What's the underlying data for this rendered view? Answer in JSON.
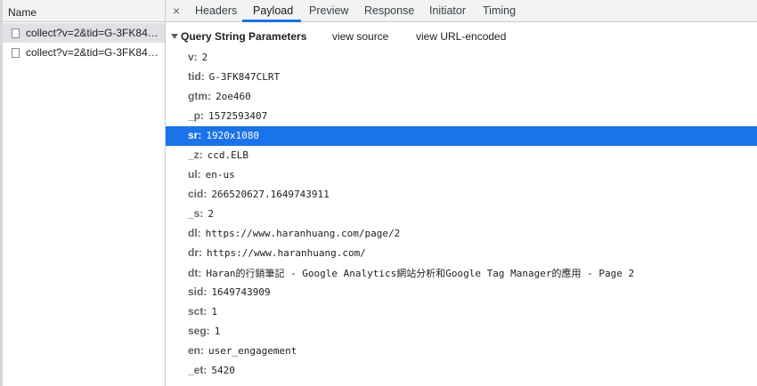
{
  "left_panel": {
    "header": "Name",
    "requests": [
      {
        "label": "collect?v=2&tid=G-3FK84…",
        "selected": true
      },
      {
        "label": "collect?v=2&tid=G-3FK84…",
        "selected": false
      }
    ]
  },
  "tabs": {
    "close_symbol": "×",
    "items": [
      "Headers",
      "Payload",
      "Preview",
      "Response",
      "Initiator",
      "Timing"
    ],
    "active": "Payload"
  },
  "payload": {
    "section_title": "Query String Parameters",
    "view_source": "view source",
    "view_url_encoded": "view URL-encoded",
    "params": [
      {
        "key": "v:",
        "value": "2"
      },
      {
        "key": "tid:",
        "value": "G-3FK847CLRT"
      },
      {
        "key": "gtm:",
        "value": "2oe460"
      },
      {
        "key": "_p:",
        "value": "1572593407"
      },
      {
        "key": "sr:",
        "value": "1920x1080",
        "selected": true
      },
      {
        "key": "_z:",
        "value": "ccd.ELB"
      },
      {
        "key": "ul:",
        "value": "en-us"
      },
      {
        "key": "cid:",
        "value": "266520627.1649743911"
      },
      {
        "key": "_s:",
        "value": "2"
      },
      {
        "key": "dl:",
        "value": "https://www.haranhuang.com/page/2"
      },
      {
        "key": "dr:",
        "value": "https://www.haranhuang.com/"
      },
      {
        "key": "dt:",
        "value": "Haran的行銷筆記 - Google Analytics網站分析和Google Tag Manager的應用 - Page 2"
      },
      {
        "key": "sid:",
        "value": "1649743909"
      },
      {
        "key": "sct:",
        "value": "1"
      },
      {
        "key": "seg:",
        "value": "1"
      },
      {
        "key": "en:",
        "value": "user_engagement"
      },
      {
        "key": "_et:",
        "value": "5420"
      }
    ]
  },
  "colors": {
    "selection": "#1a73e8",
    "tab_underline": "#1a73e8"
  }
}
